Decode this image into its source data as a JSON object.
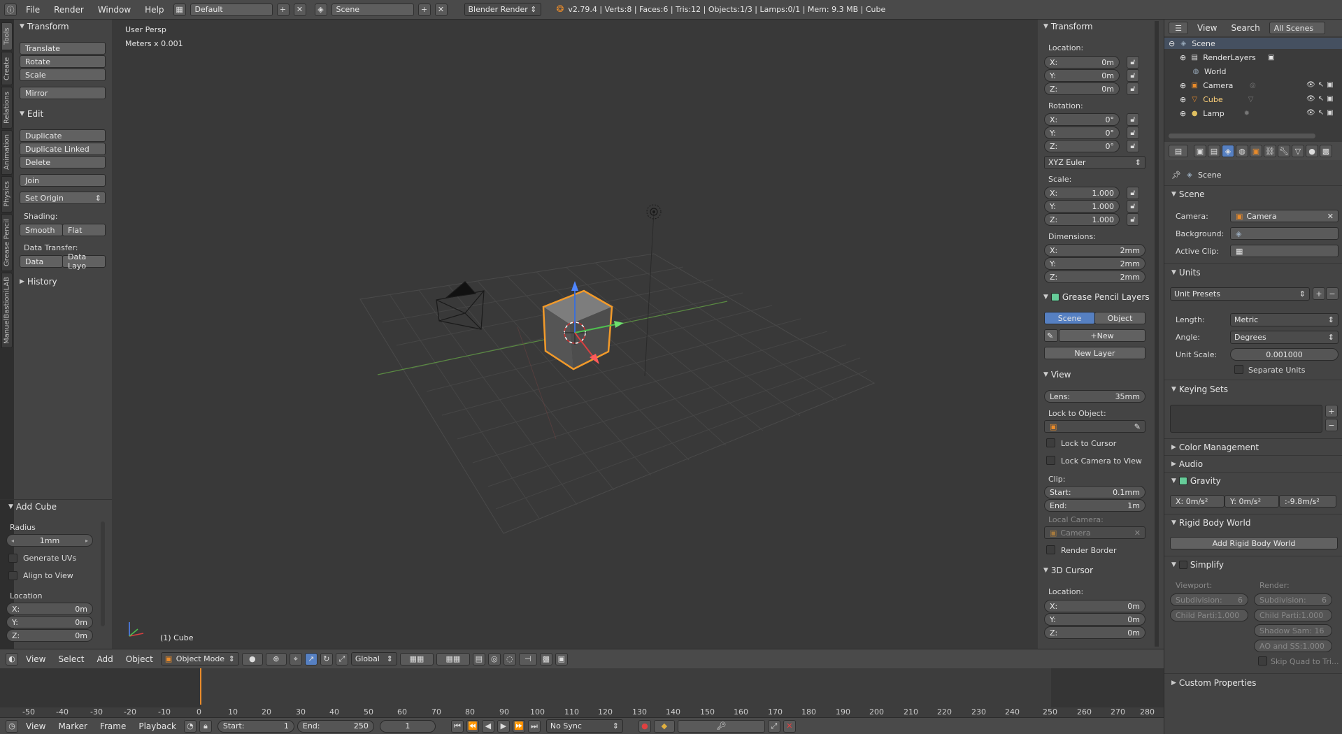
{
  "topbar": {
    "menus": [
      "File",
      "Render",
      "Window",
      "Help"
    ],
    "layout": "Default",
    "scene": "Scene",
    "engine": "Blender Render",
    "stats": "v2.79.4 | Verts:8 | Faces:6 | Tris:12 | Objects:1/3 | Lamps:0/1 | Mem: 9.3 MB | Cube"
  },
  "tabs": [
    "Tools",
    "Create",
    "Relations",
    "Animation",
    "Physics",
    "Grease Pencil",
    "ManuelBastioniLAB"
  ],
  "toolshelf": {
    "transform_title": "Transform",
    "translate": "Translate",
    "rotate": "Rotate",
    "scale": "Scale",
    "mirror": "Mirror",
    "edit_title": "Edit",
    "duplicate": "Duplicate",
    "duplicate_linked": "Duplicate Linked",
    "delete": "Delete",
    "join": "Join",
    "set_origin": "Set Origin",
    "shading_label": "Shading:",
    "smooth": "Smooth",
    "flat": "Flat",
    "data_transfer_label": "Data Transfer:",
    "data": "Data",
    "data_layo": "Data Layo",
    "history_title": "History"
  },
  "operator": {
    "title": "Add Cube",
    "radius_label": "Radius",
    "radius": "1mm",
    "generate_uvs": "Generate UVs",
    "align_to_view": "Align to View",
    "location_label": "Location",
    "x": "0m",
    "y": "0m",
    "z": "0m"
  },
  "viewport": {
    "view_name": "User Persp",
    "units": "Meters x 0.001",
    "object_label": "(1) Cube"
  },
  "npanel": {
    "transform_title": "Transform",
    "location_label": "Location:",
    "loc": [
      "0m",
      "0m",
      "0m"
    ],
    "rotation_label": "Rotation:",
    "rot": [
      "0°",
      "0°",
      "0°"
    ],
    "rotation_mode": "XYZ Euler",
    "scale_label": "Scale:",
    "scale": [
      "1.000",
      "1.000",
      "1.000"
    ],
    "dimensions_label": "Dimensions:",
    "dim": [
      "2mm",
      "2mm",
      "2mm"
    ],
    "axis": [
      "X:",
      "Y:",
      "Z:"
    ],
    "gp_title": "Grease Pencil Layers",
    "gp_scene": "Scene",
    "gp_object": "Object",
    "gp_new": "New",
    "gp_new_layer": "New Layer",
    "view_title": "View",
    "lens_label": "Lens:",
    "lens": "35mm",
    "lock_to_object": "Lock to Object:",
    "lock_to_cursor": "Lock to Cursor",
    "lock_camera": "Lock Camera to View",
    "clip_label": "Clip:",
    "clip_start_label": "Start:",
    "clip_start": "0.1mm",
    "clip_end_label": "End:",
    "clip_end": "1m",
    "local_camera": "Local Camera:",
    "camera": "Camera",
    "render_border": "Render Border",
    "cursor_title": "3D Cursor",
    "cursor_location": "Location:",
    "cursor": [
      "0m",
      "0m",
      "0m"
    ]
  },
  "vheader": {
    "menus": [
      "View",
      "Select",
      "Add",
      "Object"
    ],
    "mode": "Object Mode",
    "orientation": "Global"
  },
  "timeline": {
    "ticks": [
      "-50",
      "-40",
      "-30",
      "-20",
      "-10",
      "0",
      "10",
      "20",
      "30",
      "40",
      "50",
      "60",
      "70",
      "80",
      "90",
      "100",
      "110",
      "120",
      "130",
      "140",
      "150",
      "160",
      "170",
      "180",
      "190",
      "200",
      "210",
      "220",
      "230",
      "240",
      "250",
      "260",
      "270",
      "280"
    ],
    "menus": [
      "View",
      "Marker",
      "Frame",
      "Playback"
    ],
    "start_label": "Start:",
    "start": "1",
    "end_label": "End:",
    "end": "250",
    "current": "1",
    "sync": "No Sync"
  },
  "outliner": {
    "view": "View",
    "search": "Search",
    "filter": "All Scenes",
    "items": [
      "Scene",
      "RenderLayers",
      "World",
      "Camera",
      "Cube",
      "Lamp"
    ]
  },
  "props": {
    "breadcrumb": "Scene",
    "scene_title": "Scene",
    "camera_label": "Camera:",
    "camera": "Camera",
    "background_label": "Background:",
    "active_clip_label": "Active Clip:",
    "units_title": "Units",
    "unit_presets": "Unit Presets",
    "length_label": "Length:",
    "length": "Metric",
    "angle_label": "Angle:",
    "angle": "Degrees",
    "unit_scale_label": "Unit Scale:",
    "unit_scale": "0.001000",
    "separate_units": "Separate Units",
    "keying_title": "Keying Sets",
    "color_mgmt": "Color Management",
    "audio": "Audio",
    "gravity": "Gravity",
    "grav_x": "X:  0m/s²",
    "grav_y": "Y:  0m/s²",
    "grav_z": ":-9.8m/s²",
    "rigid_title": "Rigid Body World",
    "add_rigid": "Add Rigid Body World",
    "simplify": "Simplify",
    "viewport_label": "Viewport:",
    "render_label": "Render:",
    "subdivision": "Subdivision:",
    "subdivision_val": "6",
    "child_parti": "Child Parti:1.000",
    "shadow_sam": "Shadow Sam: 16",
    "ao_sss": "AO and SS:1.000",
    "skip_quad": "Skip Quad to Tri...",
    "custom_props": "Custom Properties"
  }
}
